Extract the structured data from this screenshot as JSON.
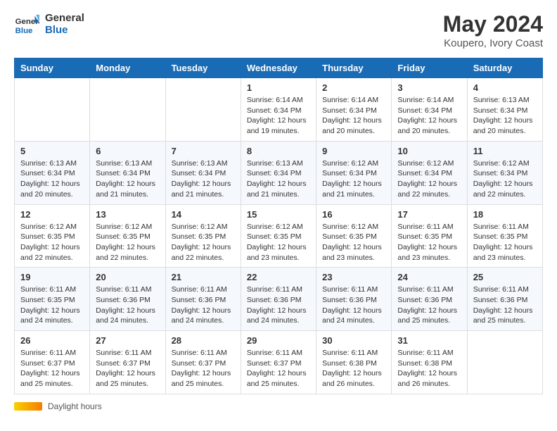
{
  "header": {
    "logo_line1": "General",
    "logo_line2": "Blue",
    "main_title": "May 2024",
    "subtitle": "Koupero, Ivory Coast"
  },
  "days_of_week": [
    "Sunday",
    "Monday",
    "Tuesday",
    "Wednesday",
    "Thursday",
    "Friday",
    "Saturday"
  ],
  "weeks": [
    [
      {
        "day": "",
        "info": ""
      },
      {
        "day": "",
        "info": ""
      },
      {
        "day": "",
        "info": ""
      },
      {
        "day": "1",
        "info": "Sunrise: 6:14 AM\nSunset: 6:34 PM\nDaylight: 12 hours and 19 minutes."
      },
      {
        "day": "2",
        "info": "Sunrise: 6:14 AM\nSunset: 6:34 PM\nDaylight: 12 hours and 20 minutes."
      },
      {
        "day": "3",
        "info": "Sunrise: 6:14 AM\nSunset: 6:34 PM\nDaylight: 12 hours and 20 minutes."
      },
      {
        "day": "4",
        "info": "Sunrise: 6:13 AM\nSunset: 6:34 PM\nDaylight: 12 hours and 20 minutes."
      }
    ],
    [
      {
        "day": "5",
        "info": "Sunrise: 6:13 AM\nSunset: 6:34 PM\nDaylight: 12 hours and 20 minutes."
      },
      {
        "day": "6",
        "info": "Sunrise: 6:13 AM\nSunset: 6:34 PM\nDaylight: 12 hours and 21 minutes."
      },
      {
        "day": "7",
        "info": "Sunrise: 6:13 AM\nSunset: 6:34 PM\nDaylight: 12 hours and 21 minutes."
      },
      {
        "day": "8",
        "info": "Sunrise: 6:13 AM\nSunset: 6:34 PM\nDaylight: 12 hours and 21 minutes."
      },
      {
        "day": "9",
        "info": "Sunrise: 6:12 AM\nSunset: 6:34 PM\nDaylight: 12 hours and 21 minutes."
      },
      {
        "day": "10",
        "info": "Sunrise: 6:12 AM\nSunset: 6:34 PM\nDaylight: 12 hours and 22 minutes."
      },
      {
        "day": "11",
        "info": "Sunrise: 6:12 AM\nSunset: 6:34 PM\nDaylight: 12 hours and 22 minutes."
      }
    ],
    [
      {
        "day": "12",
        "info": "Sunrise: 6:12 AM\nSunset: 6:35 PM\nDaylight: 12 hours and 22 minutes."
      },
      {
        "day": "13",
        "info": "Sunrise: 6:12 AM\nSunset: 6:35 PM\nDaylight: 12 hours and 22 minutes."
      },
      {
        "day": "14",
        "info": "Sunrise: 6:12 AM\nSunset: 6:35 PM\nDaylight: 12 hours and 22 minutes."
      },
      {
        "day": "15",
        "info": "Sunrise: 6:12 AM\nSunset: 6:35 PM\nDaylight: 12 hours and 23 minutes."
      },
      {
        "day": "16",
        "info": "Sunrise: 6:12 AM\nSunset: 6:35 PM\nDaylight: 12 hours and 23 minutes."
      },
      {
        "day": "17",
        "info": "Sunrise: 6:11 AM\nSunset: 6:35 PM\nDaylight: 12 hours and 23 minutes."
      },
      {
        "day": "18",
        "info": "Sunrise: 6:11 AM\nSunset: 6:35 PM\nDaylight: 12 hours and 23 minutes."
      }
    ],
    [
      {
        "day": "19",
        "info": "Sunrise: 6:11 AM\nSunset: 6:35 PM\nDaylight: 12 hours and 24 minutes."
      },
      {
        "day": "20",
        "info": "Sunrise: 6:11 AM\nSunset: 6:36 PM\nDaylight: 12 hours and 24 minutes."
      },
      {
        "day": "21",
        "info": "Sunrise: 6:11 AM\nSunset: 6:36 PM\nDaylight: 12 hours and 24 minutes."
      },
      {
        "day": "22",
        "info": "Sunrise: 6:11 AM\nSunset: 6:36 PM\nDaylight: 12 hours and 24 minutes."
      },
      {
        "day": "23",
        "info": "Sunrise: 6:11 AM\nSunset: 6:36 PM\nDaylight: 12 hours and 24 minutes."
      },
      {
        "day": "24",
        "info": "Sunrise: 6:11 AM\nSunset: 6:36 PM\nDaylight: 12 hours and 25 minutes."
      },
      {
        "day": "25",
        "info": "Sunrise: 6:11 AM\nSunset: 6:36 PM\nDaylight: 12 hours and 25 minutes."
      }
    ],
    [
      {
        "day": "26",
        "info": "Sunrise: 6:11 AM\nSunset: 6:37 PM\nDaylight: 12 hours and 25 minutes."
      },
      {
        "day": "27",
        "info": "Sunrise: 6:11 AM\nSunset: 6:37 PM\nDaylight: 12 hours and 25 minutes."
      },
      {
        "day": "28",
        "info": "Sunrise: 6:11 AM\nSunset: 6:37 PM\nDaylight: 12 hours and 25 minutes."
      },
      {
        "day": "29",
        "info": "Sunrise: 6:11 AM\nSunset: 6:37 PM\nDaylight: 12 hours and 25 minutes."
      },
      {
        "day": "30",
        "info": "Sunrise: 6:11 AM\nSunset: 6:38 PM\nDaylight: 12 hours and 26 minutes."
      },
      {
        "day": "31",
        "info": "Sunrise: 6:11 AM\nSunset: 6:38 PM\nDaylight: 12 hours and 26 minutes."
      },
      {
        "day": "",
        "info": ""
      }
    ]
  ],
  "footer": {
    "daylight_label": "Daylight hours"
  }
}
